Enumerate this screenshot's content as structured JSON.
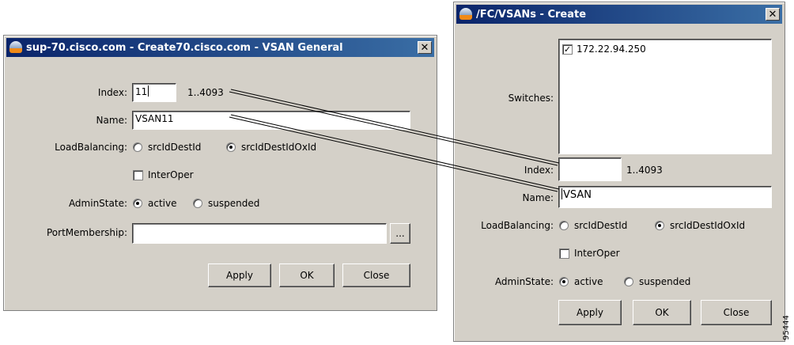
{
  "left_window": {
    "title": "sup-70.cisco.com - Create70.cisco.com - VSAN General",
    "close_label": "✕",
    "index_label": "Index:",
    "index_value": "11",
    "index_range": "1..4093",
    "name_label": "Name:",
    "name_value": "VSAN11",
    "load_balancing_label": "LoadBalancing:",
    "option_srcIdDestId": "srcIdDestId",
    "option_srcIdDestIdOxId": "srcIdDestIdOxId",
    "interoper_label": "InterOper",
    "admin_state_label": "AdminState:",
    "option_active": "active",
    "option_suspended": "suspended",
    "port_membership_label": "PortMembership:",
    "port_membership_value": "",
    "browse_label": "...",
    "apply_label": "Apply",
    "ok_label": "OK",
    "close_button_label": "Close",
    "load_balancing_selected": "srcIdDestIdOxId",
    "admin_state_selected": "active",
    "interoper_checked": false
  },
  "right_window": {
    "title": "/FC/VSANs - Create",
    "close_label": "✕",
    "switches_label": "Switches:",
    "switch_item": "172.22.94.250",
    "switch_checkmark": "✓",
    "switch_checked": true,
    "index_label": "Index:",
    "index_value": "",
    "index_range": "1..4093",
    "name_label": "Name:",
    "name_value": "VSAN",
    "load_balancing_label": "LoadBalancing:",
    "option_srcIdDestId": "srcIdDestId",
    "option_srcIdDestIdOxId": "srcIdDestIdOxId",
    "interoper_label": "InterOper",
    "admin_state_label": "AdminState:",
    "option_active": "active",
    "option_suspended": "suspended",
    "apply_label": "Apply",
    "ok_label": "OK",
    "close_button_label": "Close",
    "load_balancing_selected": "srcIdDestIdOxId",
    "admin_state_selected": "active",
    "interoper_checked": false
  },
  "figure_number": "95444"
}
